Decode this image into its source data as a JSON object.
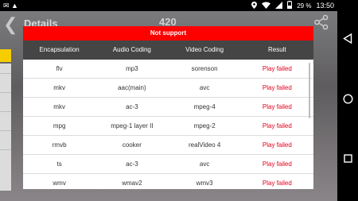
{
  "status_bar": {
    "left_icons": "✉ ▲",
    "icons": [
      "location-icon",
      "wifi-icon",
      "signal-icon",
      "battery-icon"
    ],
    "battery": "29 %",
    "time": "13:50"
  },
  "header": {
    "title": "Details",
    "count": "420"
  },
  "dialog": {
    "title": "Not support",
    "columns": [
      "Encapsulation",
      "Audio Coding",
      "Video Coding",
      "Result"
    ],
    "rows": [
      [
        "flv",
        "mp3",
        "sorenson",
        "Play failed"
      ],
      [
        "mkv",
        "aac(main)",
        "avc",
        "Play failed"
      ],
      [
        "mkv",
        "ac-3",
        "mpeg-4",
        "Play failed"
      ],
      [
        "mpg",
        "mpeg-1 layer II",
        "mpeg-2",
        "Play failed"
      ],
      [
        "rmvb",
        "cooker",
        "realVideo 4",
        "Play failed"
      ],
      [
        "ts",
        "ac-3",
        "avc",
        "Play failed"
      ],
      [
        "wmv",
        "wmav2",
        "wmv3",
        "Play failed"
      ]
    ]
  },
  "colors": {
    "dialog_title_bg": "#fd0000",
    "header_row_bg": "#454545",
    "result_text": "#e0001b",
    "accent_yellow": "#f6ce00"
  }
}
